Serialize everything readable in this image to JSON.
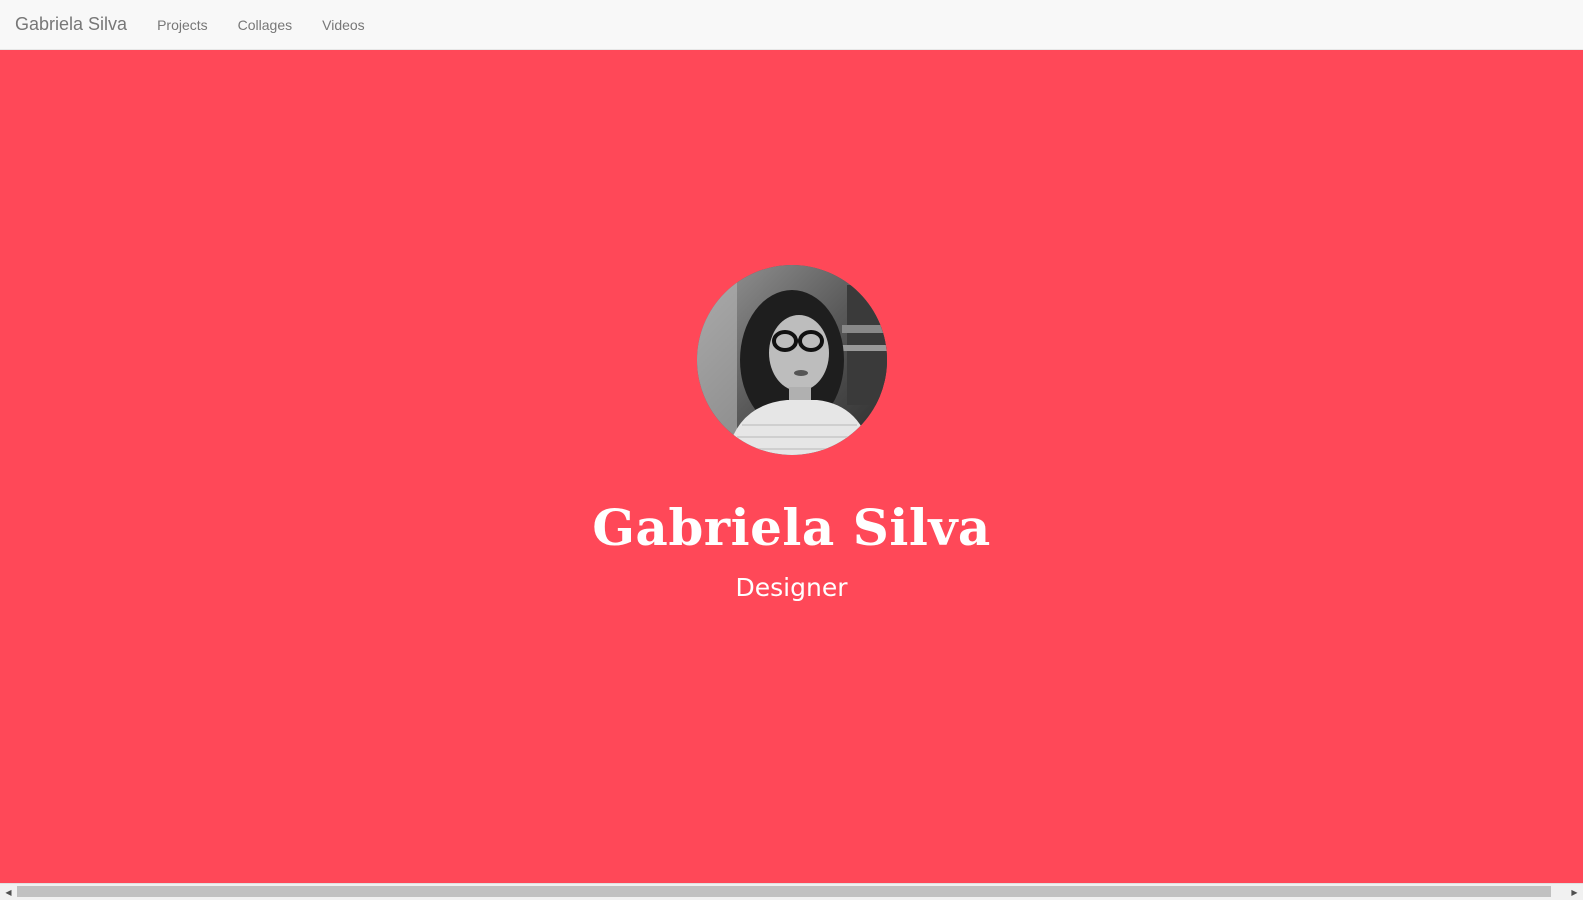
{
  "navbar": {
    "brand": "Gabriela Silva",
    "links": [
      "Projects",
      "Collages",
      "Videos"
    ]
  },
  "hero": {
    "title": "Gabriela Silva",
    "subtitle": "Designer",
    "avatar": "avatar-photo"
  },
  "scrollbar": {
    "left_icon": "scroll-left-arrow-icon",
    "right_icon": "scroll-right-arrow-icon"
  },
  "colors": {
    "hero_background": "#ff4858",
    "navbar_background": "#f8f8f8",
    "nav_text": "#777777",
    "hero_text": "#ffffff"
  }
}
